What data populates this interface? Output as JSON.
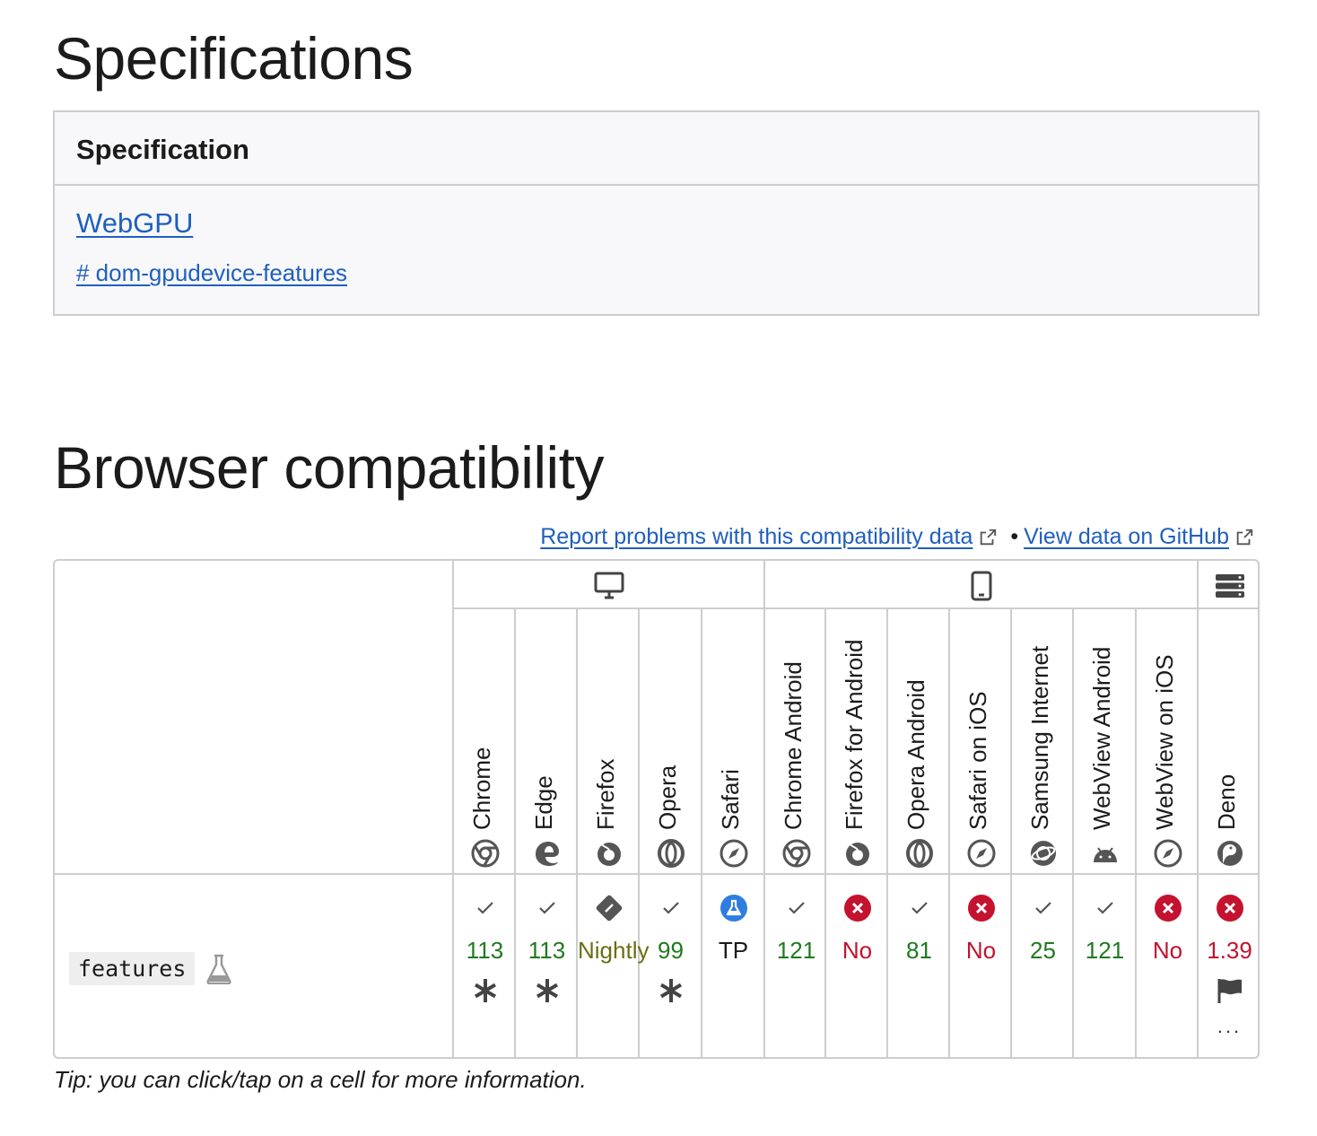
{
  "specifications": {
    "heading": "Specifications",
    "column_header": "Specification",
    "spec_name": "WebGPU",
    "spec_anchor": "# dom-gpudevice-features"
  },
  "compat": {
    "heading": "Browser compatibility",
    "report_link": "Report problems with this compatibility data",
    "separator": "•",
    "github_link": "View data on GitHub",
    "platforms": [
      "desktop-icon",
      "mobile-icon",
      "server-icon"
    ],
    "feature": "features",
    "feature_icon": "experimental-flask-icon",
    "browsers": [
      {
        "name": "Chrome",
        "version": "113",
        "status": "yes",
        "note": "asterisk"
      },
      {
        "name": "Edge",
        "version": "113",
        "status": "yes",
        "note": "asterisk"
      },
      {
        "name": "Firefox",
        "version": "Nightly",
        "status": "preview",
        "note": ""
      },
      {
        "name": "Opera",
        "version": "99",
        "status": "yes",
        "note": "asterisk"
      },
      {
        "name": "Safari",
        "version": "TP",
        "status": "tp",
        "note": ""
      },
      {
        "name": "Chrome Android",
        "version": "121",
        "status": "yes",
        "note": ""
      },
      {
        "name": "Firefox for Android",
        "version": "No",
        "status": "no",
        "note": ""
      },
      {
        "name": "Opera Android",
        "version": "81",
        "status": "yes",
        "note": ""
      },
      {
        "name": "Safari on iOS",
        "version": "No",
        "status": "no",
        "note": ""
      },
      {
        "name": "Samsung Internet",
        "version": "25",
        "status": "yes",
        "note": ""
      },
      {
        "name": "WebView Android",
        "version": "121",
        "status": "yes",
        "note": ""
      },
      {
        "name": "WebView on iOS",
        "version": "No",
        "status": "no",
        "note": ""
      },
      {
        "name": "Deno",
        "version": "1.39",
        "status": "no",
        "note": "flag",
        "more": "..."
      }
    ],
    "tip": "Tip: you can click/tap on a cell for more information.",
    "colors": {
      "supported": "#1e7a1e",
      "unsupported": "#c4122f",
      "preview": "#6d6d12",
      "link": "#1f5fbf",
      "border": "#cdcdcd"
    }
  }
}
